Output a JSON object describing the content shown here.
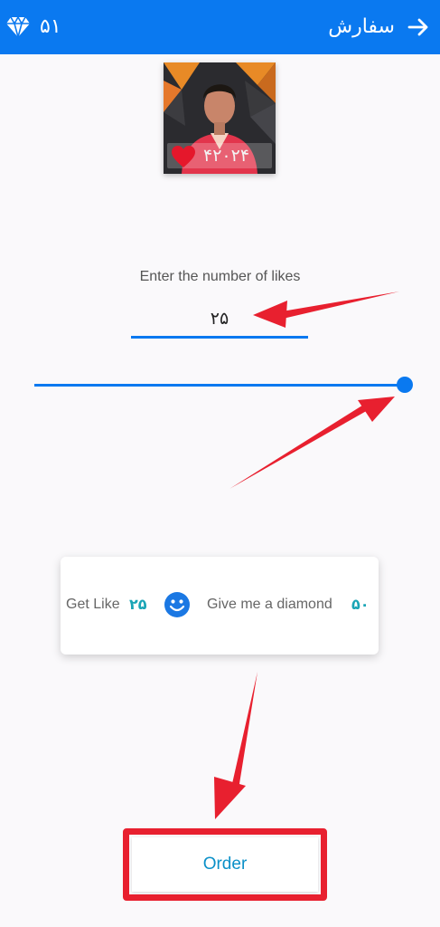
{
  "appbar": {
    "title": "سفارش",
    "diamond_count": "۵۱",
    "back_icon": "arrow-right-icon",
    "diamond_icon": "diamond-icon",
    "color": "#0a79f0"
  },
  "post": {
    "likes": "۴۲۰۲۴",
    "heart_icon": "heart-icon"
  },
  "form": {
    "label": "Enter the number of likes",
    "value": "۲۵",
    "slider_fraction": 1.0
  },
  "card": {
    "get_like_label": "Get Like",
    "get_like_value": "۲۵",
    "give_label": "Give me a diamond",
    "give_value": "۵۰",
    "smile_icon": "smile-icon"
  },
  "actions": {
    "order_label": "Order"
  },
  "colors": {
    "accent": "#0a79f0",
    "highlight": "#e8202f",
    "teal": "#1aa5b6"
  }
}
